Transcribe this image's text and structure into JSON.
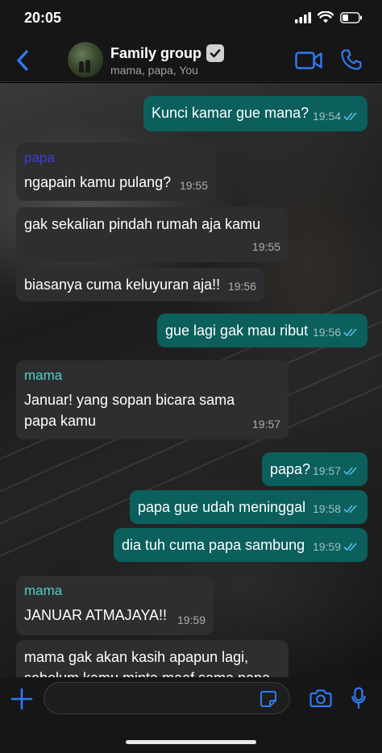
{
  "status_bar": {
    "time": "20:05"
  },
  "header": {
    "title": "Family group",
    "subtitle": "mama, papa, You"
  },
  "colors": {
    "accent": "#2f7bf5",
    "outgoing_bubble": "#0b5f5c",
    "incoming_bubble": "#2e2e31",
    "sender_papa": "#3b3fd6",
    "sender_mama": "#4fd1c5",
    "read_ticks": "#53bdeb"
  },
  "messages": [
    {
      "direction": "out",
      "text": "Kunci kamar gue mana?",
      "time": "19:54",
      "ticks": "read"
    },
    {
      "direction": "in",
      "sender": "papa",
      "text": "ngapain kamu pulang?",
      "time": "19:55"
    },
    {
      "direction": "in",
      "text": "gak sekalian pindah rumah aja kamu",
      "time": "19:55"
    },
    {
      "direction": "in",
      "text": "biasanya cuma keluyuran aja!!",
      "time": "19:56"
    },
    {
      "direction": "out",
      "text": "gue lagi gak mau ribut",
      "time": "19:56",
      "ticks": "read"
    },
    {
      "direction": "in",
      "sender": "mama",
      "text": "Januar! yang sopan bicara sama papa kamu",
      "time": "19:57"
    },
    {
      "direction": "out",
      "text": "papa?",
      "time": "19:57",
      "ticks": "read"
    },
    {
      "direction": "out",
      "text": "papa gue udah meninggal",
      "time": "19:58",
      "ticks": "read"
    },
    {
      "direction": "out",
      "text": "dia tuh cuma papa sambung",
      "time": "19:59",
      "ticks": "read"
    },
    {
      "direction": "in",
      "sender": "mama",
      "text": "JANUAR ATMAJAYA!!",
      "time": "19:59"
    },
    {
      "direction": "in",
      "text": "mama gak akan kasih apapun lagi, sebelum kamu minta maaf sama papa"
    }
  ],
  "composer": {
    "value": "",
    "placeholder": ""
  },
  "icons": {
    "back": "chevron-left-icon",
    "video": "video-camera-icon",
    "call": "phone-icon",
    "add": "plus-icon",
    "sticker": "sticker-icon",
    "camera": "camera-icon",
    "mic": "microphone-icon"
  }
}
